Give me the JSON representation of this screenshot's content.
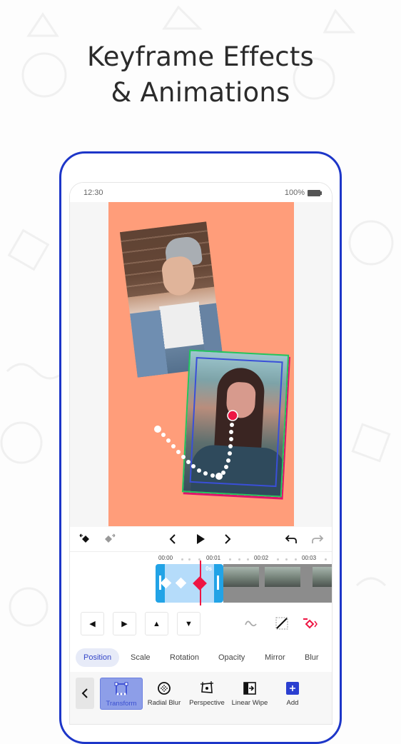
{
  "headline": {
    "line1": "Keyframe Effects",
    "line2": "& Animations"
  },
  "status_bar": {
    "time": "12:30",
    "battery": "100%",
    "battery_icon": "battery-full-icon"
  },
  "playback": {
    "prev_keyframe_icon": "keyframe-prev-icon",
    "next_keyframe_icon": "keyframe-next-icon",
    "step_back_icon": "chevron-left-icon",
    "play_icon": "play-icon",
    "step_forward_icon": "chevron-right-icon",
    "undo_icon": "undo-icon",
    "redo_icon": "redo-icon"
  },
  "timeline": {
    "ruler": [
      "00:00",
      "00:01",
      "00:02",
      "00:03"
    ],
    "clip_duration": "0s",
    "keyframes": 3,
    "active_keyframe": 3
  },
  "controls": {
    "nudge_buttons": [
      {
        "name": "nudge-left",
        "glyph": "◀"
      },
      {
        "name": "nudge-right",
        "glyph": "▶"
      },
      {
        "name": "nudge-up",
        "glyph": "▲"
      },
      {
        "name": "nudge-down",
        "glyph": "▼"
      }
    ],
    "curve_icon": "ease-curve-icon",
    "linear_icon": "linear-curve-icon",
    "keyframe_toggle_icon": "keyframe-add-icon"
  },
  "tabs": [
    {
      "label": "Position",
      "active": true
    },
    {
      "label": "Scale",
      "active": false
    },
    {
      "label": "Rotation",
      "active": false
    },
    {
      "label": "Opacity",
      "active": false
    },
    {
      "label": "Mirror",
      "active": false
    },
    {
      "label": "Blur",
      "active": false
    }
  ],
  "effects": {
    "back_icon": "chevron-left-icon",
    "items": [
      {
        "label": "Transform",
        "icon": "transform-icon",
        "active": true
      },
      {
        "label": "Radial Blur",
        "icon": "radial-blur-icon",
        "active": false
      },
      {
        "label": "Perspective",
        "icon": "perspective-icon",
        "active": false
      },
      {
        "label": "Linear Wipe",
        "icon": "linear-wipe-icon",
        "active": false
      },
      {
        "label": "Add",
        "icon": "add-icon",
        "active": false
      }
    ]
  },
  "colors": {
    "phone_frame": "#1d36c8",
    "canvas_bg": "#ff9d7a",
    "accent_red": "#ee1543",
    "clip_blue": "#22a3e6",
    "tab_active": "#3547c8"
  }
}
